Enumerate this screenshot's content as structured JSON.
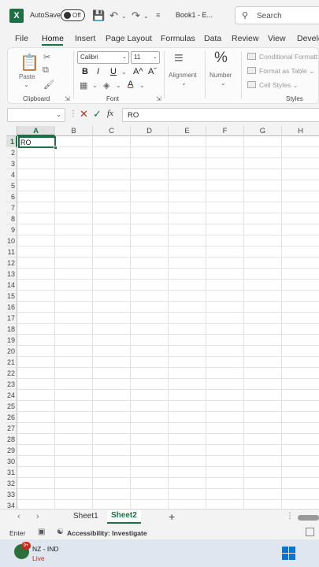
{
  "titlebar": {
    "autosave_label": "AutoSave",
    "autosave_state": "Off",
    "doc_title": "Book1 - E...",
    "search_placeholder": "Search"
  },
  "tabs": [
    "File",
    "Home",
    "Insert",
    "Page Layout",
    "Formulas",
    "Data",
    "Review",
    "View",
    "Develo"
  ],
  "active_tab": "Home",
  "ribbon": {
    "clipboard": {
      "paste_label": "Paste",
      "group_label": "Clipboard"
    },
    "font": {
      "family": "Calibri",
      "size": "11",
      "bold": "B",
      "italic": "I",
      "underline": "U",
      "grow": "A^",
      "shrink": "Aˇ",
      "color_letter": "A",
      "group_label": "Font"
    },
    "alignment": {
      "label": "Alignment"
    },
    "number": {
      "symbol": "%",
      "label": "Number"
    },
    "styles": {
      "conditional": "Conditional Formatt",
      "format_table": "Format as Table",
      "cell_styles": "Cell Styles",
      "group_label": "Styles"
    }
  },
  "formula_bar": {
    "name_box": "",
    "fx": "fx",
    "content": "RO"
  },
  "grid": {
    "columns": [
      "A",
      "B",
      "C",
      "D",
      "E",
      "F",
      "G",
      "H"
    ],
    "rows": [
      "1",
      "2",
      "3",
      "4",
      "5",
      "6",
      "7",
      "8",
      "9",
      "10",
      "11",
      "12",
      "13",
      "14",
      "15",
      "16",
      "17",
      "18",
      "19",
      "20",
      "21",
      "22",
      "23",
      "24",
      "25",
      "26",
      "27",
      "28",
      "29",
      "30",
      "31",
      "32",
      "33",
      "34"
    ],
    "active_cell_value": "RO"
  },
  "sheets": {
    "tabs": [
      "Sheet1",
      "Sheet2"
    ],
    "active": "Sheet2",
    "add": "+"
  },
  "statusbar": {
    "mode": "Enter",
    "accessibility": "Accessibility: Investigate"
  },
  "taskbar": {
    "badge": "9+",
    "news_title": "NZ - IND",
    "news_status": "Live"
  },
  "colors": {
    "accent": "#1d7044",
    "cancel": "#c42b1c",
    "windows": "#0a74d6"
  }
}
